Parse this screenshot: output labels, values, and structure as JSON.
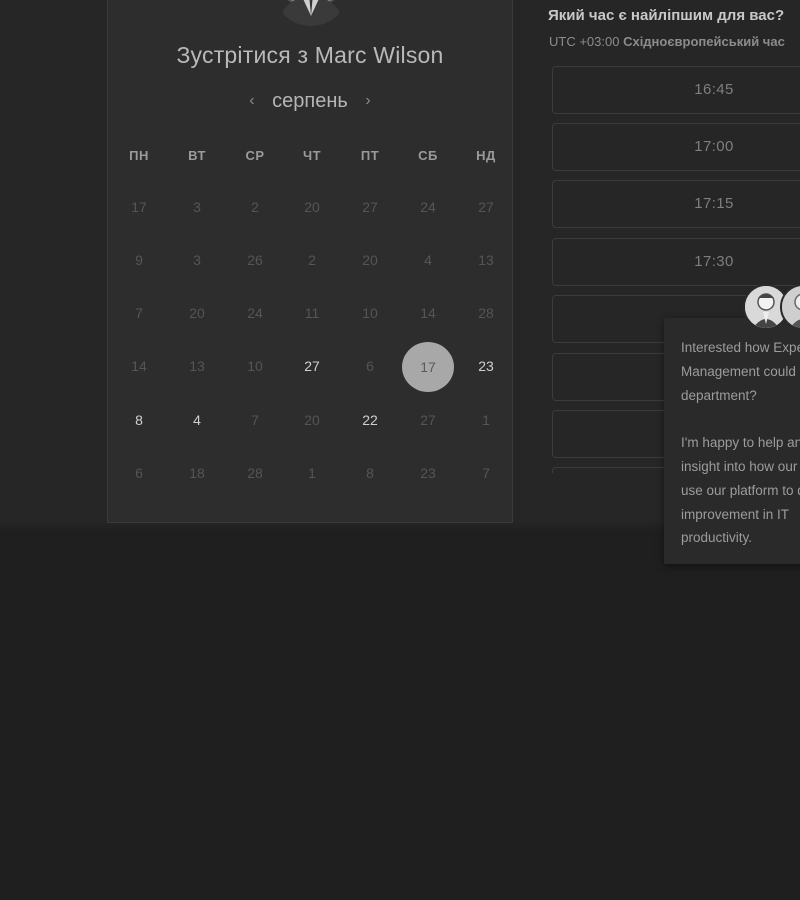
{
  "meeting": {
    "title": "Зустрітися з Marc Wilson"
  },
  "calendar": {
    "month": "серпень",
    "prev_icon": "chevron-left-icon",
    "next_icon": "chevron-right-icon",
    "weekdays": [
      "ПН",
      "ВТ",
      "СР",
      "ЧТ",
      "ПТ",
      "СБ",
      "НД"
    ],
    "weeks": [
      [
        {
          "d": "17",
          "s": "inactive"
        },
        {
          "d": "3",
          "s": "inactive"
        },
        {
          "d": "2",
          "s": "inactive"
        },
        {
          "d": "20",
          "s": "inactive"
        },
        {
          "d": "27",
          "s": "inactive"
        },
        {
          "d": "24",
          "s": "inactive"
        },
        {
          "d": "27",
          "s": "inactive"
        }
      ],
      [
        {
          "d": "9",
          "s": "inactive"
        },
        {
          "d": "3",
          "s": "inactive"
        },
        {
          "d": "26",
          "s": "inactive"
        },
        {
          "d": "2",
          "s": "inactive"
        },
        {
          "d": "20",
          "s": "inactive"
        },
        {
          "d": "4",
          "s": "inactive"
        },
        {
          "d": "13",
          "s": "inactive"
        }
      ],
      [
        {
          "d": "7",
          "s": "inactive"
        },
        {
          "d": "20",
          "s": "inactive"
        },
        {
          "d": "24",
          "s": "inactive"
        },
        {
          "d": "11",
          "s": "inactive"
        },
        {
          "d": "10",
          "s": "inactive"
        },
        {
          "d": "14",
          "s": "inactive"
        },
        {
          "d": "28",
          "s": "inactive"
        }
      ],
      [
        {
          "d": "14",
          "s": "inactive"
        },
        {
          "d": "13",
          "s": "inactive"
        },
        {
          "d": "10",
          "s": "inactive"
        },
        {
          "d": "27",
          "s": "active"
        },
        {
          "d": "6",
          "s": "inactive"
        },
        {
          "d": "17",
          "s": "selected"
        },
        {
          "d": "23",
          "s": "active"
        }
      ],
      [
        {
          "d": "8",
          "s": "active"
        },
        {
          "d": "4",
          "s": "active"
        },
        {
          "d": "7",
          "s": "inactive"
        },
        {
          "d": "20",
          "s": "inactive"
        },
        {
          "d": "22",
          "s": "active"
        },
        {
          "d": "27",
          "s": "inactive"
        },
        {
          "d": "1",
          "s": "inactive"
        }
      ],
      [
        {
          "d": "6",
          "s": "inactive"
        },
        {
          "d": "18",
          "s": "inactive"
        },
        {
          "d": "28",
          "s": "inactive"
        },
        {
          "d": "1",
          "s": "inactive"
        },
        {
          "d": "8",
          "s": "inactive"
        },
        {
          "d": "23",
          "s": "inactive"
        },
        {
          "d": "7",
          "s": "inactive"
        }
      ]
    ]
  },
  "slots": {
    "heading": "Який час є найліпшим для вас?",
    "timezone_prefix": "UTC +03:00",
    "timezone_name": "Східноєвропейський час",
    "times": [
      "16:45",
      "17:00",
      "17:15",
      "17:30",
      "",
      "",
      ""
    ]
  },
  "chat": {
    "message": "Interested how Expense\nManagement could help your\ndepartment?\n\nI'm happy to help answer any\ninsight into how our clients\nuse our platform to drive\nimprovement in IT\nproductivity."
  },
  "colors": {
    "background": "#1f1f1f",
    "panel": "#2d2d2d",
    "selected_day": "#a8a8a8"
  }
}
